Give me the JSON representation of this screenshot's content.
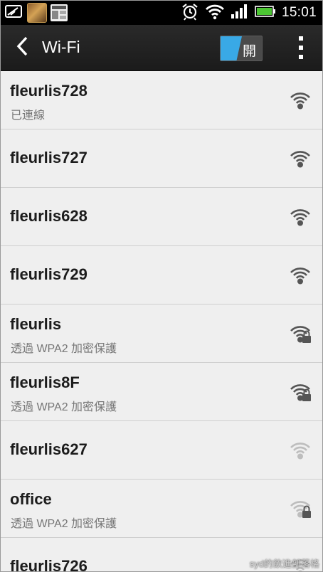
{
  "status_bar": {
    "time": "15:01",
    "icons": [
      "signal-icon",
      "news-thumbnail",
      "game-thumbnail",
      "alarm-icon",
      "wifi-status-icon",
      "cell-signal-icon",
      "battery-icon"
    ],
    "battery_color": "#4cc633"
  },
  "action_bar": {
    "title": "Wi-Fi",
    "toggle_label": "開",
    "toggle_accent": "#39a9e6"
  },
  "networks": [
    {
      "ssid": "fleurlis728",
      "subtitle": "已連線",
      "secured": false,
      "strength": "strong"
    },
    {
      "ssid": "fleurlis727",
      "subtitle": "",
      "secured": false,
      "strength": "strong"
    },
    {
      "ssid": "fleurlis628",
      "subtitle": "",
      "secured": false,
      "strength": "strong"
    },
    {
      "ssid": "fleurlis729",
      "subtitle": "",
      "secured": false,
      "strength": "strong"
    },
    {
      "ssid": "fleurlis",
      "subtitle": "透過 WPA2 加密保護",
      "secured": true,
      "strength": "strong"
    },
    {
      "ssid": "fleurlis8F",
      "subtitle": "透過 WPA2 加密保護",
      "secured": true,
      "strength": "strong"
    },
    {
      "ssid": "fleurlis627",
      "subtitle": "",
      "secured": false,
      "strength": "weak"
    },
    {
      "ssid": "office",
      "subtitle": "透過 WPA2 加密保護",
      "secured": true,
      "strength": "weak"
    },
    {
      "ssid": "fleurlis726",
      "subtitle": "",
      "secured": false,
      "strength": "weak"
    }
  ],
  "watermark": "syd的飲進部落格"
}
